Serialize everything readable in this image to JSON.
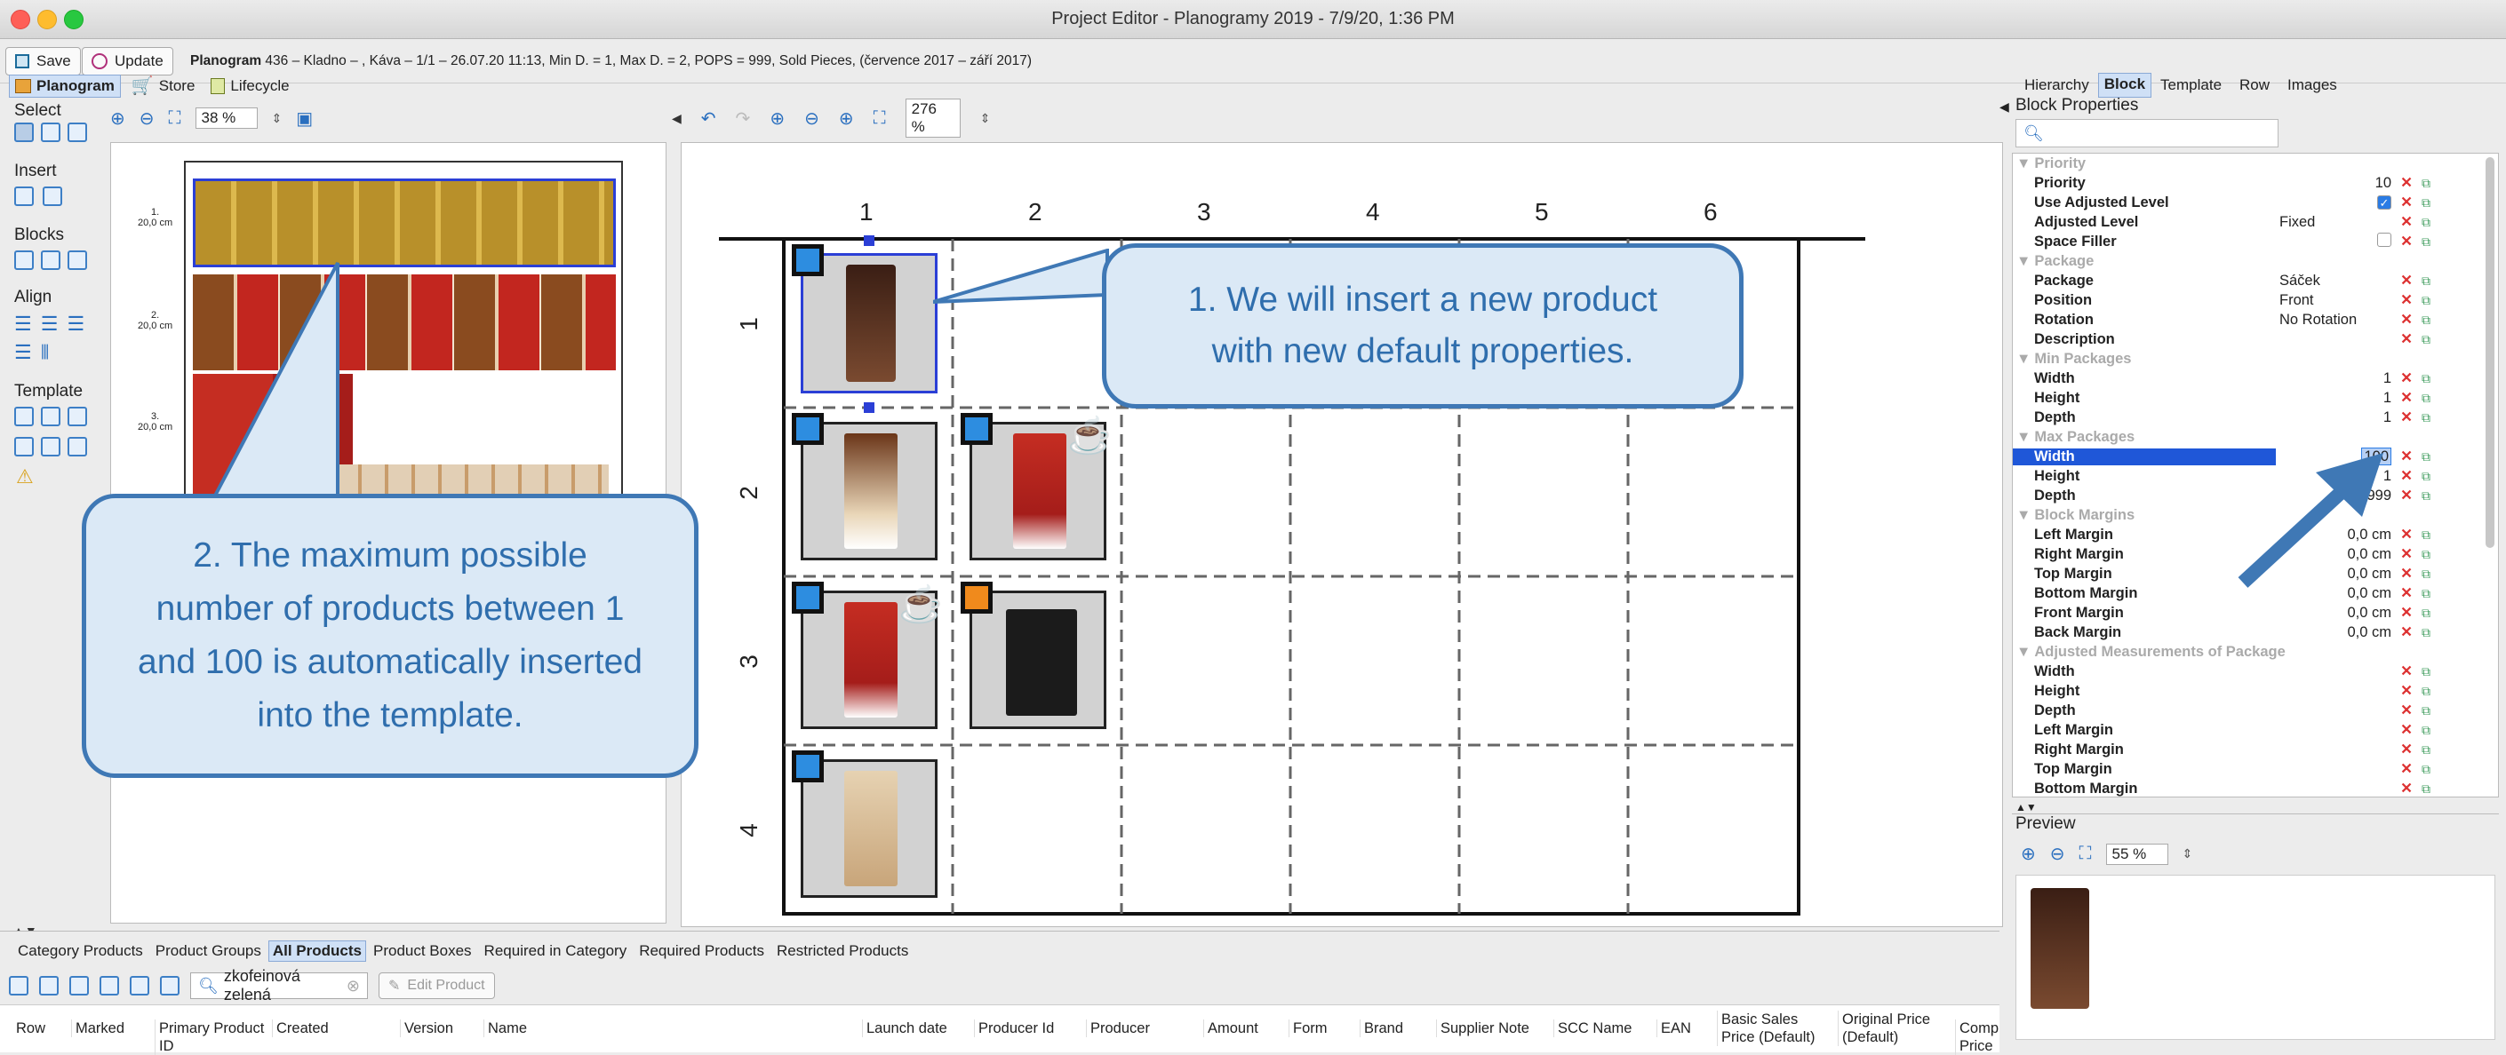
{
  "window": {
    "title": "Project Editor - Planogramy 2019 - 7/9/20, 1:36 PM"
  },
  "toolbar": {
    "save": "Save",
    "update": "Update",
    "planogram_label": "Planogram",
    "planogram_info": "436 – Kladno – , Káva – 1/1 – 26.07.20 11:13, Min D. = 1, Max D. = 2, POPS = 999, Sold Pieces, (července 2017 – září 2017)"
  },
  "view_tabs": [
    "Planogram",
    "Store",
    "Lifecycle"
  ],
  "left_tools": {
    "select": "Select",
    "insert": "Insert",
    "blocks": "Blocks",
    "align": "Align",
    "template": "Template"
  },
  "overview": {
    "zoom": "38 %",
    "shelf_labels": [
      "1.\n20,0 cm",
      "2.\n20,0 cm",
      "3.\n20,0 cm"
    ]
  },
  "editor": {
    "zoom": "276 %",
    "columns": [
      "1",
      "2",
      "3",
      "4",
      "5",
      "6"
    ],
    "rows": [
      "1",
      "2",
      "3",
      "4"
    ]
  },
  "callouts": {
    "one": "1. We will insert a new product with new default properties.",
    "two": "2. The maximum possible number of products between 1 and 100 is automatically inserted into the template."
  },
  "right_tabs": [
    "Hierarchy",
    "Block",
    "Template",
    "Row",
    "Images"
  ],
  "block_properties": {
    "title": "Block Properties",
    "rows": [
      {
        "type": "group",
        "label": "Priority"
      },
      {
        "name": "Priority",
        "value": "10"
      },
      {
        "name": "Use Adjusted Level",
        "value": "",
        "checkbox": true,
        "checked": true
      },
      {
        "name": "Adjusted Level",
        "value": "Fixed",
        "left": true
      },
      {
        "name": "Space Filler",
        "value": "",
        "checkbox": true,
        "checked": false
      },
      {
        "type": "group",
        "label": "Package"
      },
      {
        "name": "Package",
        "value": "Sáček",
        "left": true
      },
      {
        "name": "Position",
        "value": "Front",
        "left": true
      },
      {
        "name": "Rotation",
        "value": "No Rotation",
        "left": true
      },
      {
        "name": "Description",
        "value": ""
      },
      {
        "type": "group",
        "label": "Min Packages"
      },
      {
        "name": "Width",
        "value": "1"
      },
      {
        "name": "Height",
        "value": "1"
      },
      {
        "name": "Depth",
        "value": "1"
      },
      {
        "type": "group",
        "label": "Max Packages"
      },
      {
        "name": "Width",
        "value": "100",
        "selected": true
      },
      {
        "name": "Height",
        "value": "1"
      },
      {
        "name": "Depth",
        "value": "999"
      },
      {
        "type": "group",
        "label": "Block Margins"
      },
      {
        "name": "Left Margin",
        "value": "0,0 cm"
      },
      {
        "name": "Right Margin",
        "value": "0,0 cm"
      },
      {
        "name": "Top Margin",
        "value": "0,0 cm"
      },
      {
        "name": "Bottom Margin",
        "value": "0,0 cm"
      },
      {
        "name": "Front Margin",
        "value": "0,0 cm"
      },
      {
        "name": "Back Margin",
        "value": "0,0 cm"
      },
      {
        "type": "group",
        "label": "Adjusted Measurements of Package"
      },
      {
        "name": "Width",
        "value": ""
      },
      {
        "name": "Height",
        "value": ""
      },
      {
        "name": "Depth",
        "value": ""
      },
      {
        "name": "Left Margin",
        "value": ""
      },
      {
        "name": "Right Margin",
        "value": ""
      },
      {
        "name": "Top Margin",
        "value": ""
      },
      {
        "name": "Bottom Margin",
        "value": ""
      }
    ]
  },
  "preview": {
    "label": "Preview",
    "zoom": "55 %"
  },
  "bottom_tabs": [
    "Category Products",
    "Product Groups",
    "All Products",
    "Product Boxes",
    "Required in Category",
    "Required Products",
    "Restricted Products"
  ],
  "bottom_toolbar": {
    "search": "zkofeinová zelená",
    "edit": "Edit Product"
  },
  "table_headers": [
    "Row",
    "Marked",
    "Primary Product ID",
    "Created",
    "Version",
    "Name",
    "Launch date",
    "Producer Id",
    "Producer",
    "Amount",
    "Form",
    "Brand",
    "Supplier Note",
    "SCC Name",
    "EAN",
    "Basic Sales Price (Default)",
    "Original Price (Default)",
    "Comp Price"
  ],
  "colors": {
    "accent": "#3f78b5",
    "selection": "#1f57d8",
    "blue_marker": "#2d8de0",
    "orange_marker": "#f08a1c"
  }
}
